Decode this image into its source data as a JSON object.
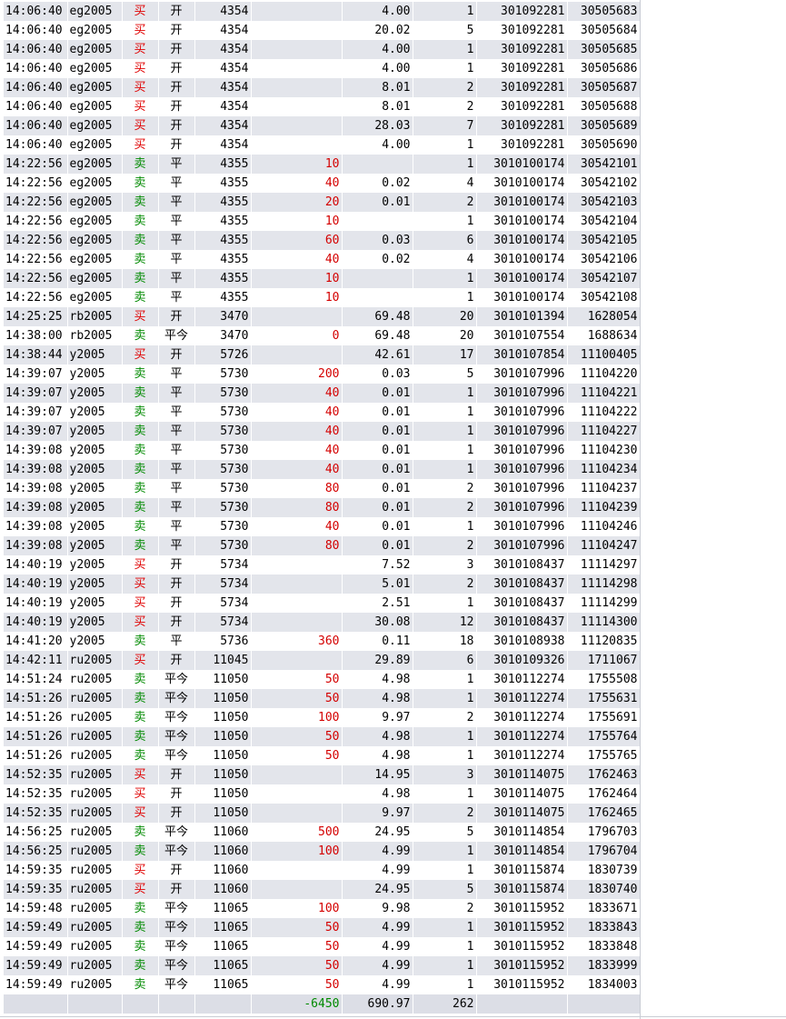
{
  "columns": [
    "time",
    "code",
    "direction",
    "open_close",
    "price",
    "pnl",
    "fee",
    "volume",
    "order_id",
    "trade_id"
  ],
  "colors": {
    "buy": "#e00000",
    "sell": "#008a00",
    "pnl": "#d40000",
    "stripe": "#e3e5eb"
  },
  "rows": [
    {
      "time": "14:06:40",
      "code": "eg2005",
      "dir": "买",
      "oc": "开",
      "price": "4354",
      "pnl": "",
      "fee": "4.00",
      "vol": "1",
      "ord": "301092281",
      "trd": "30505683"
    },
    {
      "time": "14:06:40",
      "code": "eg2005",
      "dir": "买",
      "oc": "开",
      "price": "4354",
      "pnl": "",
      "fee": "20.02",
      "vol": "5",
      "ord": "301092281",
      "trd": "30505684"
    },
    {
      "time": "14:06:40",
      "code": "eg2005",
      "dir": "买",
      "oc": "开",
      "price": "4354",
      "pnl": "",
      "fee": "4.00",
      "vol": "1",
      "ord": "301092281",
      "trd": "30505685"
    },
    {
      "time": "14:06:40",
      "code": "eg2005",
      "dir": "买",
      "oc": "开",
      "price": "4354",
      "pnl": "",
      "fee": "4.00",
      "vol": "1",
      "ord": "301092281",
      "trd": "30505686"
    },
    {
      "time": "14:06:40",
      "code": "eg2005",
      "dir": "买",
      "oc": "开",
      "price": "4354",
      "pnl": "",
      "fee": "8.01",
      "vol": "2",
      "ord": "301092281",
      "trd": "30505687"
    },
    {
      "time": "14:06:40",
      "code": "eg2005",
      "dir": "买",
      "oc": "开",
      "price": "4354",
      "pnl": "",
      "fee": "8.01",
      "vol": "2",
      "ord": "301092281",
      "trd": "30505688"
    },
    {
      "time": "14:06:40",
      "code": "eg2005",
      "dir": "买",
      "oc": "开",
      "price": "4354",
      "pnl": "",
      "fee": "28.03",
      "vol": "7",
      "ord": "301092281",
      "trd": "30505689"
    },
    {
      "time": "14:06:40",
      "code": "eg2005",
      "dir": "买",
      "oc": "开",
      "price": "4354",
      "pnl": "",
      "fee": "4.00",
      "vol": "1",
      "ord": "301092281",
      "trd": "30505690"
    },
    {
      "time": "14:22:56",
      "code": "eg2005",
      "dir": "卖",
      "oc": "平",
      "price": "4355",
      "pnl": "10",
      "fee": "",
      "vol": "1",
      "ord": "3010100174",
      "trd": "30542101"
    },
    {
      "time": "14:22:56",
      "code": "eg2005",
      "dir": "卖",
      "oc": "平",
      "price": "4355",
      "pnl": "40",
      "fee": "0.02",
      "vol": "4",
      "ord": "3010100174",
      "trd": "30542102"
    },
    {
      "time": "14:22:56",
      "code": "eg2005",
      "dir": "卖",
      "oc": "平",
      "price": "4355",
      "pnl": "20",
      "fee": "0.01",
      "vol": "2",
      "ord": "3010100174",
      "trd": "30542103"
    },
    {
      "time": "14:22:56",
      "code": "eg2005",
      "dir": "卖",
      "oc": "平",
      "price": "4355",
      "pnl": "10",
      "fee": "",
      "vol": "1",
      "ord": "3010100174",
      "trd": "30542104"
    },
    {
      "time": "14:22:56",
      "code": "eg2005",
      "dir": "卖",
      "oc": "平",
      "price": "4355",
      "pnl": "60",
      "fee": "0.03",
      "vol": "6",
      "ord": "3010100174",
      "trd": "30542105"
    },
    {
      "time": "14:22:56",
      "code": "eg2005",
      "dir": "卖",
      "oc": "平",
      "price": "4355",
      "pnl": "40",
      "fee": "0.02",
      "vol": "4",
      "ord": "3010100174",
      "trd": "30542106"
    },
    {
      "time": "14:22:56",
      "code": "eg2005",
      "dir": "卖",
      "oc": "平",
      "price": "4355",
      "pnl": "10",
      "fee": "",
      "vol": "1",
      "ord": "3010100174",
      "trd": "30542107"
    },
    {
      "time": "14:22:56",
      "code": "eg2005",
      "dir": "卖",
      "oc": "平",
      "price": "4355",
      "pnl": "10",
      "fee": "",
      "vol": "1",
      "ord": "3010100174",
      "trd": "30542108"
    },
    {
      "time": "14:25:25",
      "code": "rb2005",
      "dir": "买",
      "oc": "开",
      "price": "3470",
      "pnl": "",
      "fee": "69.48",
      "vol": "20",
      "ord": "3010101394",
      "trd": "1628054"
    },
    {
      "time": "14:38:00",
      "code": "rb2005",
      "dir": "卖",
      "oc": "平今",
      "price": "3470",
      "pnl": "0",
      "fee": "69.48",
      "vol": "20",
      "ord": "3010107554",
      "trd": "1688634"
    },
    {
      "time": "14:38:44",
      "code": "y2005",
      "dir": "买",
      "oc": "开",
      "price": "5726",
      "pnl": "",
      "fee": "42.61",
      "vol": "17",
      "ord": "3010107854",
      "trd": "11100405"
    },
    {
      "time": "14:39:07",
      "code": "y2005",
      "dir": "卖",
      "oc": "平",
      "price": "5730",
      "pnl": "200",
      "fee": "0.03",
      "vol": "5",
      "ord": "3010107996",
      "trd": "11104220"
    },
    {
      "time": "14:39:07",
      "code": "y2005",
      "dir": "卖",
      "oc": "平",
      "price": "5730",
      "pnl": "40",
      "fee": "0.01",
      "vol": "1",
      "ord": "3010107996",
      "trd": "11104221"
    },
    {
      "time": "14:39:07",
      "code": "y2005",
      "dir": "卖",
      "oc": "平",
      "price": "5730",
      "pnl": "40",
      "fee": "0.01",
      "vol": "1",
      "ord": "3010107996",
      "trd": "11104222"
    },
    {
      "time": "14:39:07",
      "code": "y2005",
      "dir": "卖",
      "oc": "平",
      "price": "5730",
      "pnl": "40",
      "fee": "0.01",
      "vol": "1",
      "ord": "3010107996",
      "trd": "11104227"
    },
    {
      "time": "14:39:08",
      "code": "y2005",
      "dir": "卖",
      "oc": "平",
      "price": "5730",
      "pnl": "40",
      "fee": "0.01",
      "vol": "1",
      "ord": "3010107996",
      "trd": "11104230"
    },
    {
      "time": "14:39:08",
      "code": "y2005",
      "dir": "卖",
      "oc": "平",
      "price": "5730",
      "pnl": "40",
      "fee": "0.01",
      "vol": "1",
      "ord": "3010107996",
      "trd": "11104234"
    },
    {
      "time": "14:39:08",
      "code": "y2005",
      "dir": "卖",
      "oc": "平",
      "price": "5730",
      "pnl": "80",
      "fee": "0.01",
      "vol": "2",
      "ord": "3010107996",
      "trd": "11104237"
    },
    {
      "time": "14:39:08",
      "code": "y2005",
      "dir": "卖",
      "oc": "平",
      "price": "5730",
      "pnl": "80",
      "fee": "0.01",
      "vol": "2",
      "ord": "3010107996",
      "trd": "11104239"
    },
    {
      "time": "14:39:08",
      "code": "y2005",
      "dir": "卖",
      "oc": "平",
      "price": "5730",
      "pnl": "40",
      "fee": "0.01",
      "vol": "1",
      "ord": "3010107996",
      "trd": "11104246"
    },
    {
      "time": "14:39:08",
      "code": "y2005",
      "dir": "卖",
      "oc": "平",
      "price": "5730",
      "pnl": "80",
      "fee": "0.01",
      "vol": "2",
      "ord": "3010107996",
      "trd": "11104247"
    },
    {
      "time": "14:40:19",
      "code": "y2005",
      "dir": "买",
      "oc": "开",
      "price": "5734",
      "pnl": "",
      "fee": "7.52",
      "vol": "3",
      "ord": "3010108437",
      "trd": "11114297"
    },
    {
      "time": "14:40:19",
      "code": "y2005",
      "dir": "买",
      "oc": "开",
      "price": "5734",
      "pnl": "",
      "fee": "5.01",
      "vol": "2",
      "ord": "3010108437",
      "trd": "11114298"
    },
    {
      "time": "14:40:19",
      "code": "y2005",
      "dir": "买",
      "oc": "开",
      "price": "5734",
      "pnl": "",
      "fee": "2.51",
      "vol": "1",
      "ord": "3010108437",
      "trd": "11114299"
    },
    {
      "time": "14:40:19",
      "code": "y2005",
      "dir": "买",
      "oc": "开",
      "price": "5734",
      "pnl": "",
      "fee": "30.08",
      "vol": "12",
      "ord": "3010108437",
      "trd": "11114300"
    },
    {
      "time": "14:41:20",
      "code": "y2005",
      "dir": "卖",
      "oc": "平",
      "price": "5736",
      "pnl": "360",
      "fee": "0.11",
      "vol": "18",
      "ord": "3010108938",
      "trd": "11120835"
    },
    {
      "time": "14:42:11",
      "code": "ru2005",
      "dir": "买",
      "oc": "开",
      "price": "11045",
      "pnl": "",
      "fee": "29.89",
      "vol": "6",
      "ord": "3010109326",
      "trd": "1711067"
    },
    {
      "time": "14:51:24",
      "code": "ru2005",
      "dir": "卖",
      "oc": "平今",
      "price": "11050",
      "pnl": "50",
      "fee": "4.98",
      "vol": "1",
      "ord": "3010112274",
      "trd": "1755508"
    },
    {
      "time": "14:51:26",
      "code": "ru2005",
      "dir": "卖",
      "oc": "平今",
      "price": "11050",
      "pnl": "50",
      "fee": "4.98",
      "vol": "1",
      "ord": "3010112274",
      "trd": "1755631"
    },
    {
      "time": "14:51:26",
      "code": "ru2005",
      "dir": "卖",
      "oc": "平今",
      "price": "11050",
      "pnl": "100",
      "fee": "9.97",
      "vol": "2",
      "ord": "3010112274",
      "trd": "1755691"
    },
    {
      "time": "14:51:26",
      "code": "ru2005",
      "dir": "卖",
      "oc": "平今",
      "price": "11050",
      "pnl": "50",
      "fee": "4.98",
      "vol": "1",
      "ord": "3010112274",
      "trd": "1755764"
    },
    {
      "time": "14:51:26",
      "code": "ru2005",
      "dir": "卖",
      "oc": "平今",
      "price": "11050",
      "pnl": "50",
      "fee": "4.98",
      "vol": "1",
      "ord": "3010112274",
      "trd": "1755765"
    },
    {
      "time": "14:52:35",
      "code": "ru2005",
      "dir": "买",
      "oc": "开",
      "price": "11050",
      "pnl": "",
      "fee": "14.95",
      "vol": "3",
      "ord": "3010114075",
      "trd": "1762463"
    },
    {
      "time": "14:52:35",
      "code": "ru2005",
      "dir": "买",
      "oc": "开",
      "price": "11050",
      "pnl": "",
      "fee": "4.98",
      "vol": "1",
      "ord": "3010114075",
      "trd": "1762464"
    },
    {
      "time": "14:52:35",
      "code": "ru2005",
      "dir": "买",
      "oc": "开",
      "price": "11050",
      "pnl": "",
      "fee": "9.97",
      "vol": "2",
      "ord": "3010114075",
      "trd": "1762465"
    },
    {
      "time": "14:56:25",
      "code": "ru2005",
      "dir": "卖",
      "oc": "平今",
      "price": "11060",
      "pnl": "500",
      "fee": "24.95",
      "vol": "5",
      "ord": "3010114854",
      "trd": "1796703"
    },
    {
      "time": "14:56:25",
      "code": "ru2005",
      "dir": "卖",
      "oc": "平今",
      "price": "11060",
      "pnl": "100",
      "fee": "4.99",
      "vol": "1",
      "ord": "3010114854",
      "trd": "1796704"
    },
    {
      "time": "14:59:35",
      "code": "ru2005",
      "dir": "买",
      "oc": "开",
      "price": "11060",
      "pnl": "",
      "fee": "4.99",
      "vol": "1",
      "ord": "3010115874",
      "trd": "1830739"
    },
    {
      "time": "14:59:35",
      "code": "ru2005",
      "dir": "买",
      "oc": "开",
      "price": "11060",
      "pnl": "",
      "fee": "24.95",
      "vol": "5",
      "ord": "3010115874",
      "trd": "1830740"
    },
    {
      "time": "14:59:48",
      "code": "ru2005",
      "dir": "卖",
      "oc": "平今",
      "price": "11065",
      "pnl": "100",
      "fee": "9.98",
      "vol": "2",
      "ord": "3010115952",
      "trd": "1833671"
    },
    {
      "time": "14:59:49",
      "code": "ru2005",
      "dir": "卖",
      "oc": "平今",
      "price": "11065",
      "pnl": "50",
      "fee": "4.99",
      "vol": "1",
      "ord": "3010115952",
      "trd": "1833843"
    },
    {
      "time": "14:59:49",
      "code": "ru2005",
      "dir": "卖",
      "oc": "平今",
      "price": "11065",
      "pnl": "50",
      "fee": "4.99",
      "vol": "1",
      "ord": "3010115952",
      "trd": "1833848"
    },
    {
      "time": "14:59:49",
      "code": "ru2005",
      "dir": "卖",
      "oc": "平今",
      "price": "11065",
      "pnl": "50",
      "fee": "4.99",
      "vol": "1",
      "ord": "3010115952",
      "trd": "1833999"
    },
    {
      "time": "14:59:49",
      "code": "ru2005",
      "dir": "卖",
      "oc": "平今",
      "price": "11065",
      "pnl": "50",
      "fee": "4.99",
      "vol": "1",
      "ord": "3010115952",
      "trd": "1834003"
    }
  ],
  "total": {
    "pnl": "-6450",
    "fee": "690.97",
    "vol": "262"
  }
}
